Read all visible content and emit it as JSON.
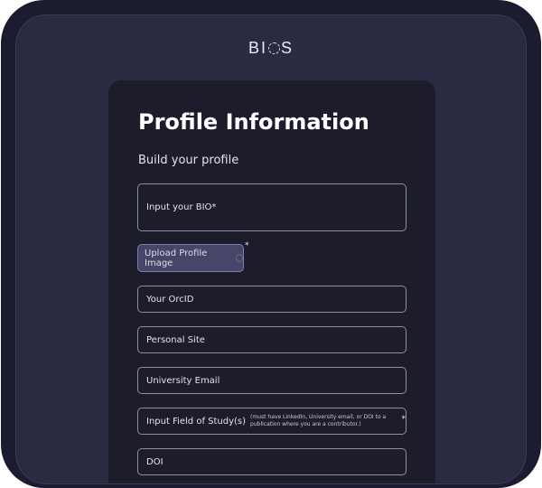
{
  "app": {
    "logo_text_left": "BI",
    "logo_text_right": "S"
  },
  "form": {
    "title": "Profile Information",
    "subtitle": "Build your profile",
    "bio_placeholder": "Input your BIO",
    "required_mark": "*",
    "upload_label": "Upload Profile Image",
    "orcid_placeholder": "Your OrcID",
    "personal_site_placeholder": "Personal Site",
    "university_email_placeholder": "University Email",
    "field_of_study_placeholder": "Input Field of Study(s)",
    "field_of_study_note": "(must have LinkedIn, University email, or DOI to a publication where you are a contributor.)",
    "doi_placeholder": "DOI"
  }
}
